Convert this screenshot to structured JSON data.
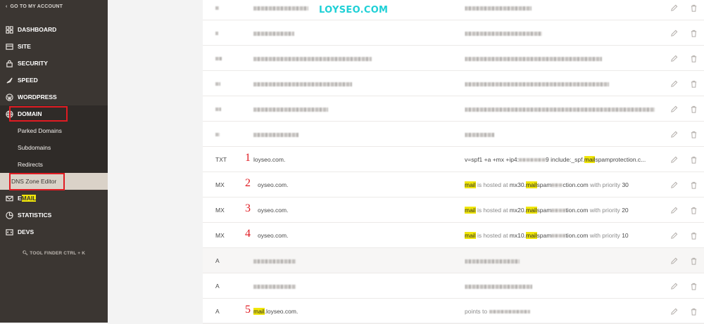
{
  "sidebar": {
    "back_label": "GO TO MY ACCOUNT",
    "items": [
      {
        "label": "DASHBOARD",
        "icon": "grid-icon"
      },
      {
        "label": "SITE",
        "icon": "site-icon"
      },
      {
        "label": "SECURITY",
        "icon": "lock-icon"
      },
      {
        "label": "SPEED",
        "icon": "rocket-icon"
      },
      {
        "label": "WORDPRESS",
        "icon": "wordpress-icon"
      },
      {
        "label": "DOMAIN",
        "icon": "globe-icon"
      },
      {
        "label_prefix": "E",
        "label_highlight": "MAIL",
        "icon": "envelope-icon"
      },
      {
        "label": "STATISTICS",
        "icon": "pie-chart-icon"
      },
      {
        "label": "DEVS",
        "icon": "code-icon"
      }
    ],
    "domain_subitems": [
      "Parked Domains",
      "Subdomains",
      "Redirects",
      "DNS Zone Editor"
    ],
    "tool_finder": "TOOL FINDER CTRL + K"
  },
  "watermark": "LOYSEO.COM",
  "highlight_color": "#f0e60a",
  "annotation_color": "#e01b22",
  "records": [
    {
      "type": "TXT",
      "num": "1",
      "name": "loyseo.com.",
      "value_a": "v=spf1 +a +mx +ip4:",
      "value_b": "9 include:_spf.",
      "value_hl": "mail",
      "value_c": "spamprotection.c..."
    },
    {
      "type": "MX",
      "num": "2",
      "name": "oyseo.com.",
      "value_hl": "mail",
      "value_a": " is hosted at ",
      "value_b": "mx30.",
      "value_hl2": "mail",
      "value_c": "spam",
      "value_d": "ction.com",
      "value_e": " with priority ",
      "value_f": "30"
    },
    {
      "type": "MX",
      "num": "3",
      "name": "oyseo.com.",
      "value_hl": "mail",
      "value_a": " is hosted at ",
      "value_b": "mx20.",
      "value_hl2": "mail",
      "value_c": "spam",
      "value_d": "tion.com",
      "value_e": " with priority ",
      "value_f": "20"
    },
    {
      "type": "MX",
      "num": "4",
      "name": "oyseo.com.",
      "value_hl": "mail",
      "value_a": " is hosted at ",
      "value_b": "mx10.",
      "value_hl2": "mail",
      "value_c": "spam",
      "value_d": "tion.com",
      "value_e": " with priority ",
      "value_f": "10"
    },
    {
      "type": "A"
    },
    {
      "type": "A"
    },
    {
      "type": "A",
      "num": "5",
      "name_hl": "mail",
      "name_rest": ".loyseo.com.",
      "value_a": "points to"
    }
  ]
}
